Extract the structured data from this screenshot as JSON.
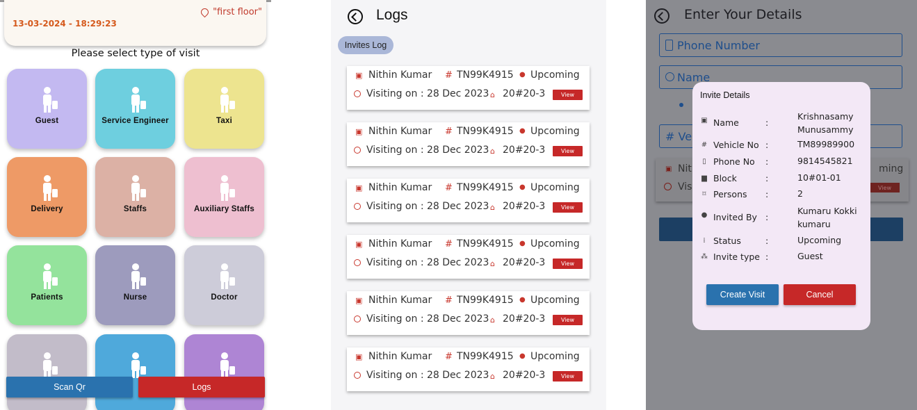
{
  "visit_screen": {
    "datetime": "13-03-2024 -  18:29:23",
    "location": "\"first floor\"",
    "prompt": "Please select type of visit",
    "tiles": [
      {
        "label": "Guest",
        "color": "#c3b9f1",
        "icon": "guest-icon"
      },
      {
        "label": "Service Engineer",
        "color": "#6ecfdf",
        "icon": "service-engineer-icon"
      },
      {
        "label": "Taxi",
        "color": "#ede48f",
        "icon": "taxi-icon"
      },
      {
        "label": "Delivery",
        "color": "#ee9a66",
        "icon": "delivery-icon"
      },
      {
        "label": "Staffs",
        "color": "#dcb1a5",
        "icon": "staff-icon"
      },
      {
        "label": "Auxiliary Staffs",
        "color": "#eebfd0",
        "icon": "auxiliary-staff-icon"
      },
      {
        "label": "Patients",
        "color": "#94e39c",
        "icon": "patient-icon"
      },
      {
        "label": "Nurse",
        "color": "#9d9bbd",
        "icon": "nurse-icon"
      },
      {
        "label": "Doctor",
        "color": "#cdccd9",
        "icon": "doctor-icon"
      },
      {
        "label": "",
        "color": "#c2bcc9",
        "icon": "worker-icon"
      },
      {
        "label": "",
        "color": "#4fa9db",
        "icon": "cleaner-icon"
      },
      {
        "label": "",
        "color": "#ae85d4",
        "icon": "teacher-icon"
      }
    ],
    "scan_label": "Scan Qr",
    "logs_label": "Logs",
    "scan_color": "#2a72ae",
    "logs_color": "#c62828"
  },
  "logs_screen": {
    "title": "Logs",
    "tab_label": "Invites Log",
    "entries": [
      {
        "name": "Nithin Kumar",
        "vehicle": "TN99K4915",
        "status": "Upcoming",
        "visiting": "Visiting on : 28 Dec 2023",
        "unit": "20#20-3",
        "view_label": "View"
      },
      {
        "name": "Nithin Kumar",
        "vehicle": "TN99K4915",
        "status": "Upcoming",
        "visiting": "Visiting on : 28 Dec 2023",
        "unit": "20#20-3",
        "view_label": "View"
      },
      {
        "name": "Nithin Kumar",
        "vehicle": "TN99K4915",
        "status": "Upcoming",
        "visiting": "Visiting on : 28 Dec 2023",
        "unit": "20#20-3",
        "view_label": "View"
      },
      {
        "name": "Nithin Kumar",
        "vehicle": "TN99K4915",
        "status": "Upcoming",
        "visiting": "Visiting on : 28 Dec 2023",
        "unit": "20#20-3",
        "view_label": "View"
      },
      {
        "name": "Nithin Kumar",
        "vehicle": "TN99K4915",
        "status": "Upcoming",
        "visiting": "Visiting on : 28 Dec 2023",
        "unit": "20#20-3",
        "view_label": "View"
      },
      {
        "name": "Nithin Kumar",
        "vehicle": "TN99K4915",
        "status": "Upcoming",
        "visiting": "Visiting on : 28 Dec 2023",
        "unit": "20#20-3",
        "view_label": "View"
      }
    ]
  },
  "details_screen": {
    "title": "Enter Your Details",
    "phone_placeholder": "Phone Number",
    "name_placeholder": "Name",
    "vehicle_partial": "# Vehi",
    "bg_card": {
      "name_partial": "Nith",
      "visit_partial": "Visi",
      "status_partial": "ming",
      "view_label": "View"
    },
    "modal": {
      "title": "Invite Details",
      "rows": [
        {
          "icon": "id-card-icon",
          "label": "Name",
          "value": "Krishnasamy Munusammy"
        },
        {
          "icon": "hash-icon",
          "label": "Vehicle No",
          "value": "TM89989900"
        },
        {
          "icon": "phone-icon",
          "label": "Phone No",
          "value": "9814545821"
        },
        {
          "icon": "building-icon",
          "label": "Block",
          "value": "10#01-01"
        },
        {
          "icon": "ticket-icon",
          "label": "Persons",
          "value": "2"
        },
        {
          "icon": "pin-icon",
          "label": "Invited By",
          "value": "Kumaru Kokki kumaru"
        },
        {
          "icon": "dots-icon",
          "label": "Status",
          "value": "Upcoming"
        },
        {
          "icon": "network-icon",
          "label": "Invite type",
          "value": "Guest"
        }
      ],
      "colon": ":",
      "create_label": "Create Visit",
      "cancel_label": "Cancel",
      "create_color": "#2a72ae",
      "cancel_color": "#c62828"
    }
  }
}
